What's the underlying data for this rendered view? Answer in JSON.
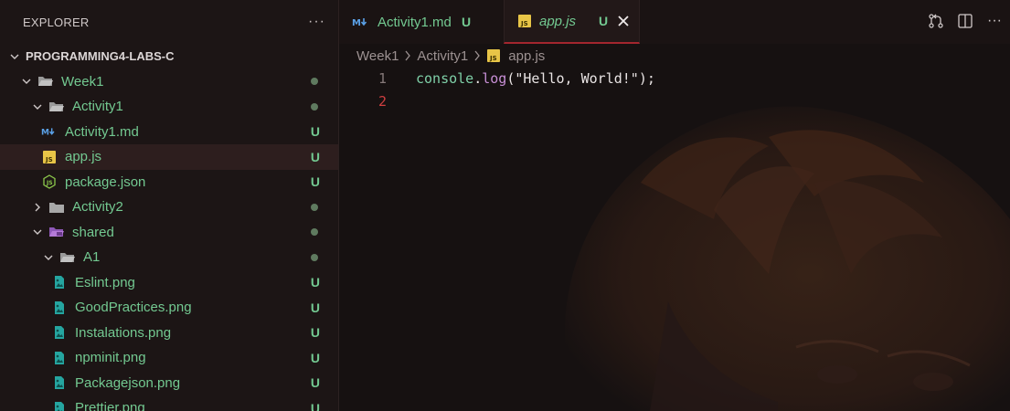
{
  "explorer": {
    "title": "EXPLORER",
    "more_icon": "more-icon"
  },
  "tree": [
    {
      "label": "PROGRAMMING4-LABS-C",
      "kind": "root",
      "depth": 0,
      "expanded": true,
      "status": ""
    },
    {
      "label": "Week1",
      "kind": "folder-open",
      "depth": 1,
      "expanded": true,
      "status": "dot"
    },
    {
      "label": "Activity1",
      "kind": "folder-open",
      "depth": 2,
      "expanded": true,
      "status": "dot"
    },
    {
      "label": "Activity1.md",
      "kind": "markdown",
      "depth": 3,
      "status": "U"
    },
    {
      "label": "app.js",
      "kind": "js",
      "depth": 3,
      "status": "U",
      "selected": true
    },
    {
      "label": "package.json",
      "kind": "node",
      "depth": 3,
      "status": "U"
    },
    {
      "label": "Activity2",
      "kind": "folder",
      "depth": 2,
      "expanded": false,
      "status": "dot"
    },
    {
      "label": "shared",
      "kind": "folder-shared",
      "depth": 2,
      "expanded": true,
      "status": "dot"
    },
    {
      "label": "A1",
      "kind": "folder-open",
      "depth": 3,
      "expanded": true,
      "status": "dot"
    },
    {
      "label": "Eslint.png",
      "kind": "image",
      "depth": 4,
      "status": "U"
    },
    {
      "label": "GoodPractices.png",
      "kind": "image",
      "depth": 4,
      "status": "U"
    },
    {
      "label": "Instalations.png",
      "kind": "image",
      "depth": 4,
      "status": "U"
    },
    {
      "label": "npminit.png",
      "kind": "image",
      "depth": 4,
      "status": "U"
    },
    {
      "label": "Packagejson.png",
      "kind": "image",
      "depth": 4,
      "status": "U"
    },
    {
      "label": "Prettier.png",
      "kind": "image",
      "depth": 4,
      "status": "U"
    }
  ],
  "tabs": [
    {
      "label": "Activity1.md",
      "status": "U",
      "icon": "markdown-icon"
    },
    {
      "label": "app.js",
      "status": "U",
      "icon": "js-icon",
      "active": true
    }
  ],
  "tab_actions": [
    "source-control-icon",
    "split-editor-icon",
    "more-actions-icon"
  ],
  "breadcrumb": [
    "Week1",
    "Activity1",
    "app.js"
  ],
  "code": {
    "line_numbers": [
      "1",
      "2"
    ],
    "line1": {
      "object": "console",
      "dot": ".",
      "method": "log",
      "open": "(",
      "string": "\"Hello, World!\"",
      "close": ");"
    }
  },
  "colors": {
    "git_untracked": "#73c991",
    "git_dot": "#5f7a5f",
    "selected_row": "#2d1e1e",
    "tab_accent": "#a3262e",
    "line_number_active": "#d03f40",
    "code_object": "#7fd0a8",
    "code_method": "#c88fd6",
    "code_string": "#e9e4e4"
  }
}
